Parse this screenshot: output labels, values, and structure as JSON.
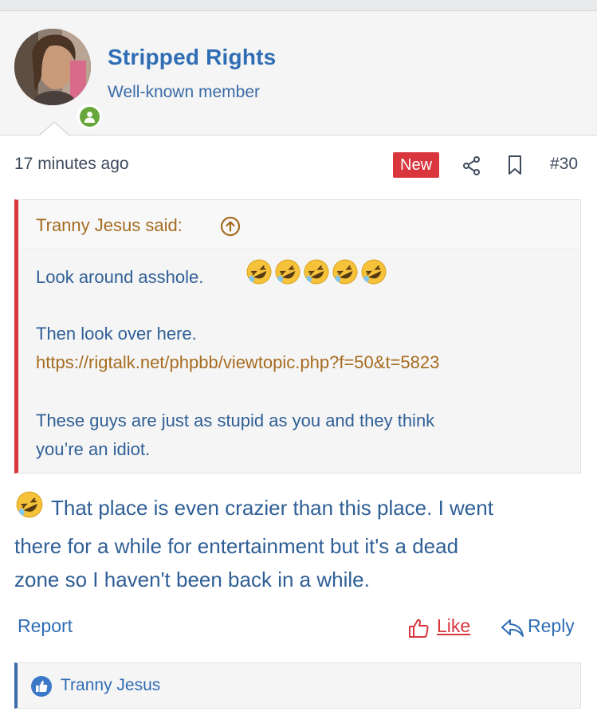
{
  "user": {
    "name": "Stripped Rights",
    "title": "Well-known member",
    "status": "online"
  },
  "meta": {
    "time": "17 minutes ago",
    "new_badge": "New",
    "post_number": "#30"
  },
  "quote": {
    "author": "Tranny Jesus said:",
    "line1": "Look around asshole.",
    "emoji_count": 5,
    "line2": "Then look over here.",
    "link": "https://rigtalk.net/phpbb/viewtopic.php?f=50&t=5823",
    "line3": "These guys are just as stupid as you and they think",
    "line4": "you’re an idiot."
  },
  "body": {
    "line1": "That place is even crazier than this place. I went",
    "line2": "there for a while for entertainment but it's a dead",
    "line3": "zone so I haven't been back in a while."
  },
  "actions": {
    "report": "Report",
    "like": "Like",
    "reply": "Reply"
  },
  "likes": {
    "names": "Tranny Jesus"
  },
  "icons": {
    "share": "share-icon",
    "bookmark": "bookmark-icon",
    "quote_up": "arrow-up-circle-icon",
    "like": "thumbs-up-icon",
    "reply": "reply-icon",
    "reaction": "rofl-emoji"
  },
  "colors": {
    "username": "#2f6db5",
    "accent_red": "#d9363e",
    "quote_author": "#a56b1f",
    "online": "#67a73b"
  }
}
